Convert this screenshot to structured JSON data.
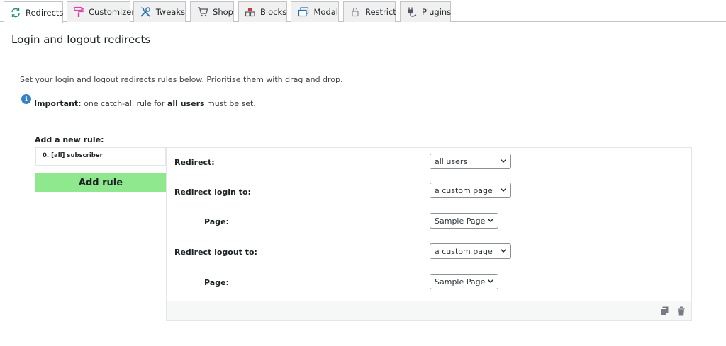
{
  "tabs": [
    {
      "label": "Redirects",
      "icon": "redirect-icon",
      "active": true
    },
    {
      "label": "Customizer",
      "icon": "paint-roller-icon"
    },
    {
      "label": "Tweaks",
      "icon": "tools-icon"
    },
    {
      "label": "Shop",
      "icon": "cart-icon"
    },
    {
      "label": "Blocks",
      "icon": "blocks-icon"
    },
    {
      "label": "Modal",
      "icon": "modal-icon"
    },
    {
      "label": "Restrict",
      "icon": "lock-icon"
    },
    {
      "label": "Plugins",
      "icon": "plugin-icon"
    }
  ],
  "page": {
    "title": "Login and logout redirects",
    "intro": "Set your login and logout redirects rules below. Prioritise them with drag and drop.",
    "notice_strong": "Important:",
    "notice_mid": " one catch-all rule for ",
    "notice_bold2": "all users",
    "notice_end": " must be set."
  },
  "rules": {
    "add_label": "Add a new rule:",
    "items": [
      "0. [all] subscriber"
    ],
    "add_button": "Add rule"
  },
  "rule_form": {
    "redirect_label": "Redirect:",
    "redirect_value": "all users",
    "login_label": "Redirect login to:",
    "login_value": "a custom page",
    "login_page_label": "Page:",
    "login_page_value": "Sample Page",
    "logout_label": "Redirect logout to:",
    "logout_value": "a custom page",
    "logout_page_label": "Page:",
    "logout_page_value": "Sample Page"
  },
  "colors": {
    "accent_green": "#90e88e",
    "info_blue": "#3582c4",
    "redirect_teal": "#1f8f7a",
    "customizer_pink": "#d946a8",
    "plugin_purple": "#7e3b8a"
  }
}
